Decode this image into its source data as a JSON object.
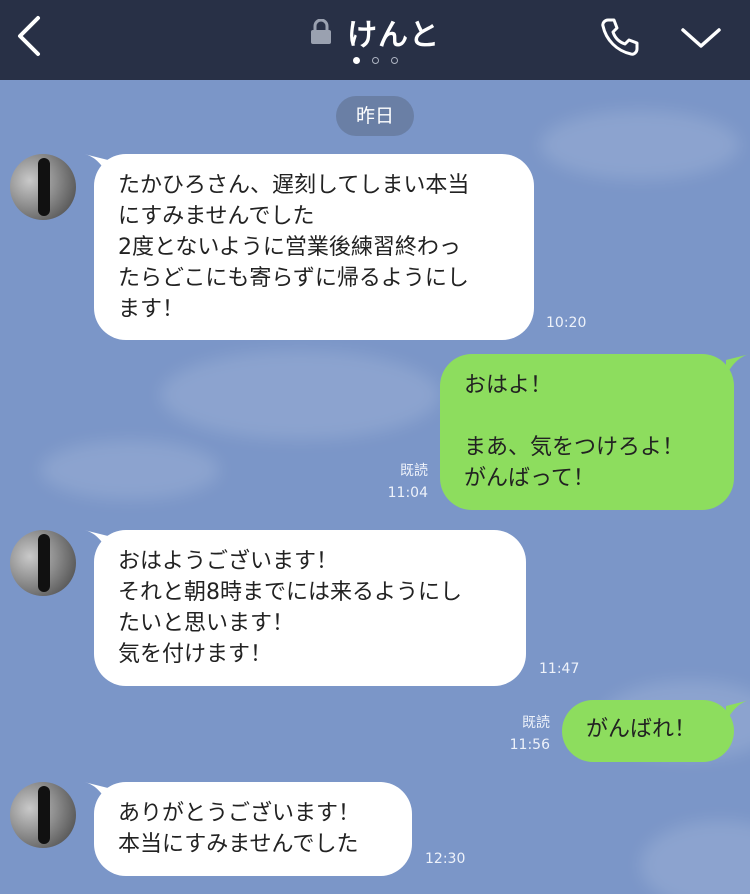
{
  "header": {
    "title": "けんと",
    "back_icon": "chevron-left-icon",
    "lock_icon": "lock-icon",
    "call_icon": "phone-icon",
    "menu_icon": "chevron-down-icon",
    "page_indicator": {
      "count": 3,
      "active": 1
    }
  },
  "chat": {
    "date_label": "昨日",
    "messages": [
      {
        "side": "in",
        "text": "たかひろさん、遅刻してしまい本当\nにすみませんでした\n2度とないように営業後練習終わっ\nたらどこにも寄らずに帰るようにし\nます！",
        "time": "10:20"
      },
      {
        "side": "out",
        "text": "おはよ！\n\nまあ、気をつけろよ！\nがんばって！",
        "read": "既読",
        "time": "11:04"
      },
      {
        "side": "in",
        "text": "おはようございます！\nそれと朝8時までには来るようにし\nたいと思います！\n気を付けます！",
        "time": "11:47"
      },
      {
        "side": "out",
        "text": "がんばれ！",
        "read": "既読",
        "time": "11:56"
      },
      {
        "side": "in",
        "text": "ありがとうございます！\n本当にすみませんでした",
        "time": "12:30"
      }
    ]
  },
  "colors": {
    "header_bg": "#283046",
    "chat_bg": "#7b96c8",
    "outgoing_bubble": "#8ddd5e",
    "incoming_bubble": "#ffffff",
    "date_pill": "#6a7fa5"
  }
}
